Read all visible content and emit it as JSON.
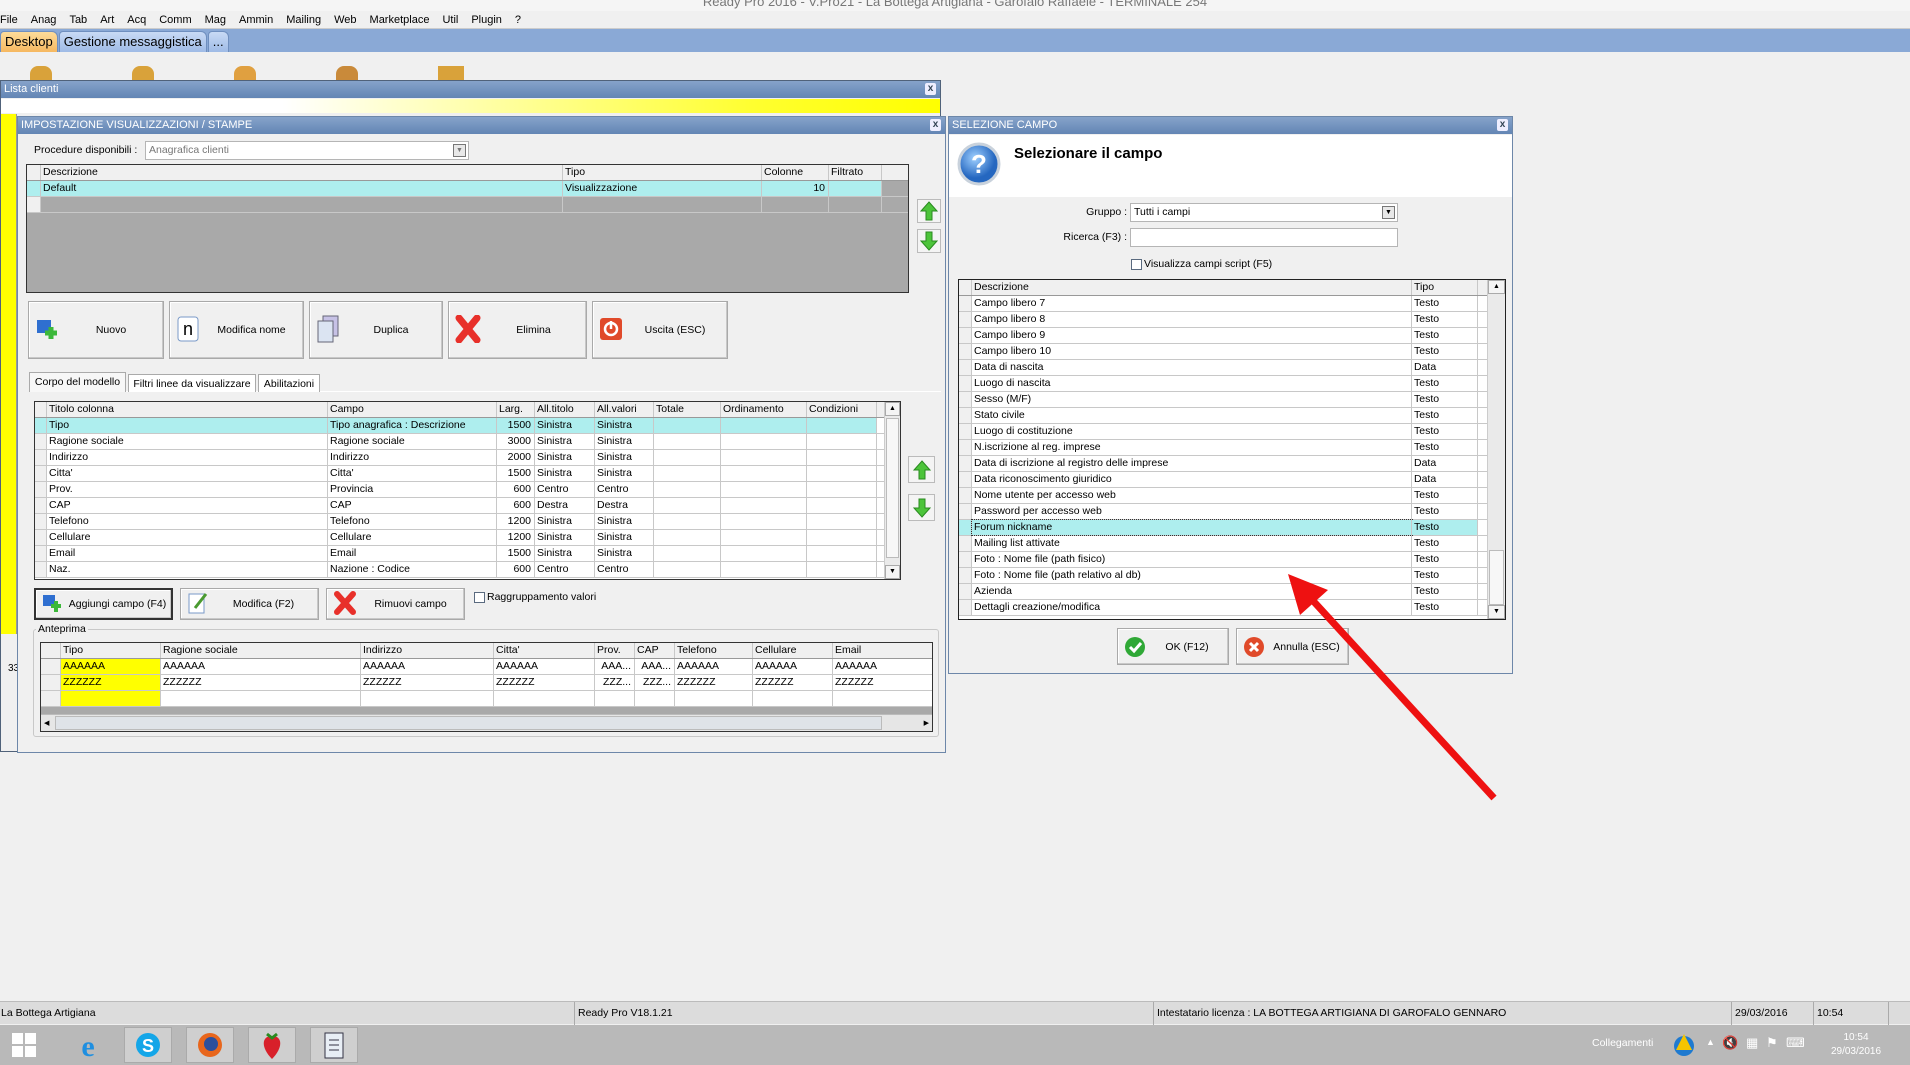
{
  "window_title": "Ready Pro 2016 - V.Pro21 - La Bottega Artigiana - Garofalo Raffaele - TERMINALE 254",
  "menu": [
    "File",
    "Anag",
    "Tab",
    "Art",
    "Acq",
    "Comm",
    "Mag",
    "Ammin",
    "Mailing",
    "Web",
    "Marketplace",
    "Util",
    "Plugin",
    "?"
  ],
  "tabs": [
    {
      "label": "Desktop",
      "active": true
    },
    {
      "label": "Gestione messaggistica"
    },
    {
      "label": "..."
    }
  ],
  "lista_clienti": {
    "title": "Lista clienti",
    "side_text": "33"
  },
  "impostazione": {
    "title": "IMPOSTAZIONE VISUALIZZAZIONI / STAMPE",
    "procedure_label": "Procedure disponibili :",
    "procedure_value": "Anagrafica clienti",
    "models": {
      "headers": [
        "Descrizione",
        "Tipo",
        "Colonne",
        "Filtrato"
      ],
      "rows": [
        [
          "Default",
          "Visualizzazione",
          "10",
          ""
        ],
        [
          "",
          "",
          "",
          ""
        ]
      ]
    },
    "buttons": [
      "Nuovo",
      "Modifica nome",
      "Duplica",
      "Elimina",
      "Uscita (ESC)"
    ],
    "subtabs": [
      "Corpo del modello",
      "Filtri linee da visualizzare",
      "Abilitazioni"
    ],
    "columns": {
      "headers": [
        "Titolo colonna",
        "Campo",
        "Larg.",
        "All.titolo",
        "All.valori",
        "Totale",
        "Ordinamento",
        "Condizioni"
      ],
      "rows": [
        [
          "Tipo",
          "Tipo anagrafica : Descrizione",
          "1500",
          "Sinistra",
          "Sinistra",
          "",
          "",
          ""
        ],
        [
          "Ragione sociale",
          "Ragione sociale",
          "3000",
          "Sinistra",
          "Sinistra",
          "",
          "",
          ""
        ],
        [
          "Indirizzo",
          "Indirizzo",
          "2000",
          "Sinistra",
          "Sinistra",
          "",
          "",
          ""
        ],
        [
          "Citta'",
          "Citta'",
          "1500",
          "Sinistra",
          "Sinistra",
          "",
          "",
          ""
        ],
        [
          "Prov.",
          "Provincia",
          "600",
          "Centro",
          "Centro",
          "",
          "",
          ""
        ],
        [
          "CAP",
          "CAP",
          "600",
          "Destra",
          "Destra",
          "",
          "",
          ""
        ],
        [
          "Telefono",
          "Telefono",
          "1200",
          "Sinistra",
          "Sinistra",
          "",
          "",
          ""
        ],
        [
          "Cellulare",
          "Cellulare",
          "1200",
          "Sinistra",
          "Sinistra",
          "",
          "",
          ""
        ],
        [
          "Email",
          "Email",
          "1500",
          "Sinistra",
          "Sinistra",
          "",
          "",
          ""
        ],
        [
          "Naz.",
          "Nazione : Codice",
          "600",
          "Centro",
          "Centro",
          "",
          "",
          ""
        ]
      ]
    },
    "field_buttons": [
      "Aggiungi campo (F4)",
      "Modifica (F2)",
      "Rimuovi campo"
    ],
    "grouping_label": "Raggruppamento valori",
    "preview": {
      "label": "Anteprima",
      "headers": [
        "Tipo",
        "Ragione sociale",
        "Indirizzo",
        "Citta'",
        "Prov.",
        "CAP",
        "Telefono",
        "Cellulare",
        "Email"
      ],
      "rows": [
        [
          "AAAAAA",
          "AAAAAA",
          "AAAAAA",
          "AAAAAA",
          "AAA...",
          "AAA...",
          "AAAAAA",
          "AAAAAA",
          "AAAAAA"
        ],
        [
          "ZZZZZZ",
          "ZZZZZZ",
          "ZZZZZZ",
          "ZZZZZZ",
          "ZZZ...",
          "ZZZ...",
          "ZZZZZZ",
          "ZZZZZZ",
          "ZZZZZZ"
        ],
        [
          "",
          "",
          "",
          "",
          "",
          "",
          "",
          "",
          ""
        ]
      ]
    }
  },
  "selezione": {
    "title": "SELEZIONE CAMPO",
    "heading": "Selezionare il campo",
    "gruppo_label": "Gruppo :",
    "gruppo_value": "Tutti i campi",
    "ricerca_label": "Ricerca (F3) :",
    "ricerca_value": "",
    "script_label": "Visualizza campi script (F5)",
    "list": {
      "headers": [
        "Descrizione",
        "Tipo"
      ],
      "selected_index": 14,
      "rows": [
        [
          "Campo libero 7",
          "Testo"
        ],
        [
          "Campo libero 8",
          "Testo"
        ],
        [
          "Campo libero 9",
          "Testo"
        ],
        [
          "Campo libero 10",
          "Testo"
        ],
        [
          "Data di nascita",
          "Data"
        ],
        [
          "Luogo di nascita",
          "Testo"
        ],
        [
          "Sesso (M/F)",
          "Testo"
        ],
        [
          "Stato civile",
          "Testo"
        ],
        [
          "Luogo di costituzione",
          "Testo"
        ],
        [
          "N.iscrizione al reg. imprese",
          "Testo"
        ],
        [
          "Data di iscrizione al registro delle imprese",
          "Data"
        ],
        [
          "Data riconoscimento giuridico",
          "Data"
        ],
        [
          "Nome utente per accesso web",
          "Testo"
        ],
        [
          "Password per accesso web",
          "Testo"
        ],
        [
          "Forum nickname",
          "Testo"
        ],
        [
          "Mailing list attivate",
          "Testo"
        ],
        [
          "Foto : Nome file (path fisico)",
          "Testo"
        ],
        [
          "Foto : Nome file (path relativo al db)",
          "Testo"
        ],
        [
          "Azienda",
          "Testo"
        ],
        [
          "Dettagli creazione/modifica",
          "Testo"
        ]
      ]
    },
    "ok": "OK (F12)",
    "annulla": "Annulla (ESC)"
  },
  "status": {
    "company": "La Bottega Artigiana",
    "version": "Ready Pro V18.1.21",
    "license": "Intestatario licenza : LA BOTTEGA ARTIGIANA DI GAROFALO GENNARO",
    "date": "29/03/2016",
    "time": "10:54"
  },
  "taskbar": {
    "collegamenti": "Collegamenti",
    "time": "10:54",
    "date": "29/03/2016"
  },
  "colors": {
    "selection": "#aeeeee",
    "titlebar": "#6b8bb8",
    "tabbar": "#8aa9d6",
    "annotation_arrow": "#ee1111"
  }
}
